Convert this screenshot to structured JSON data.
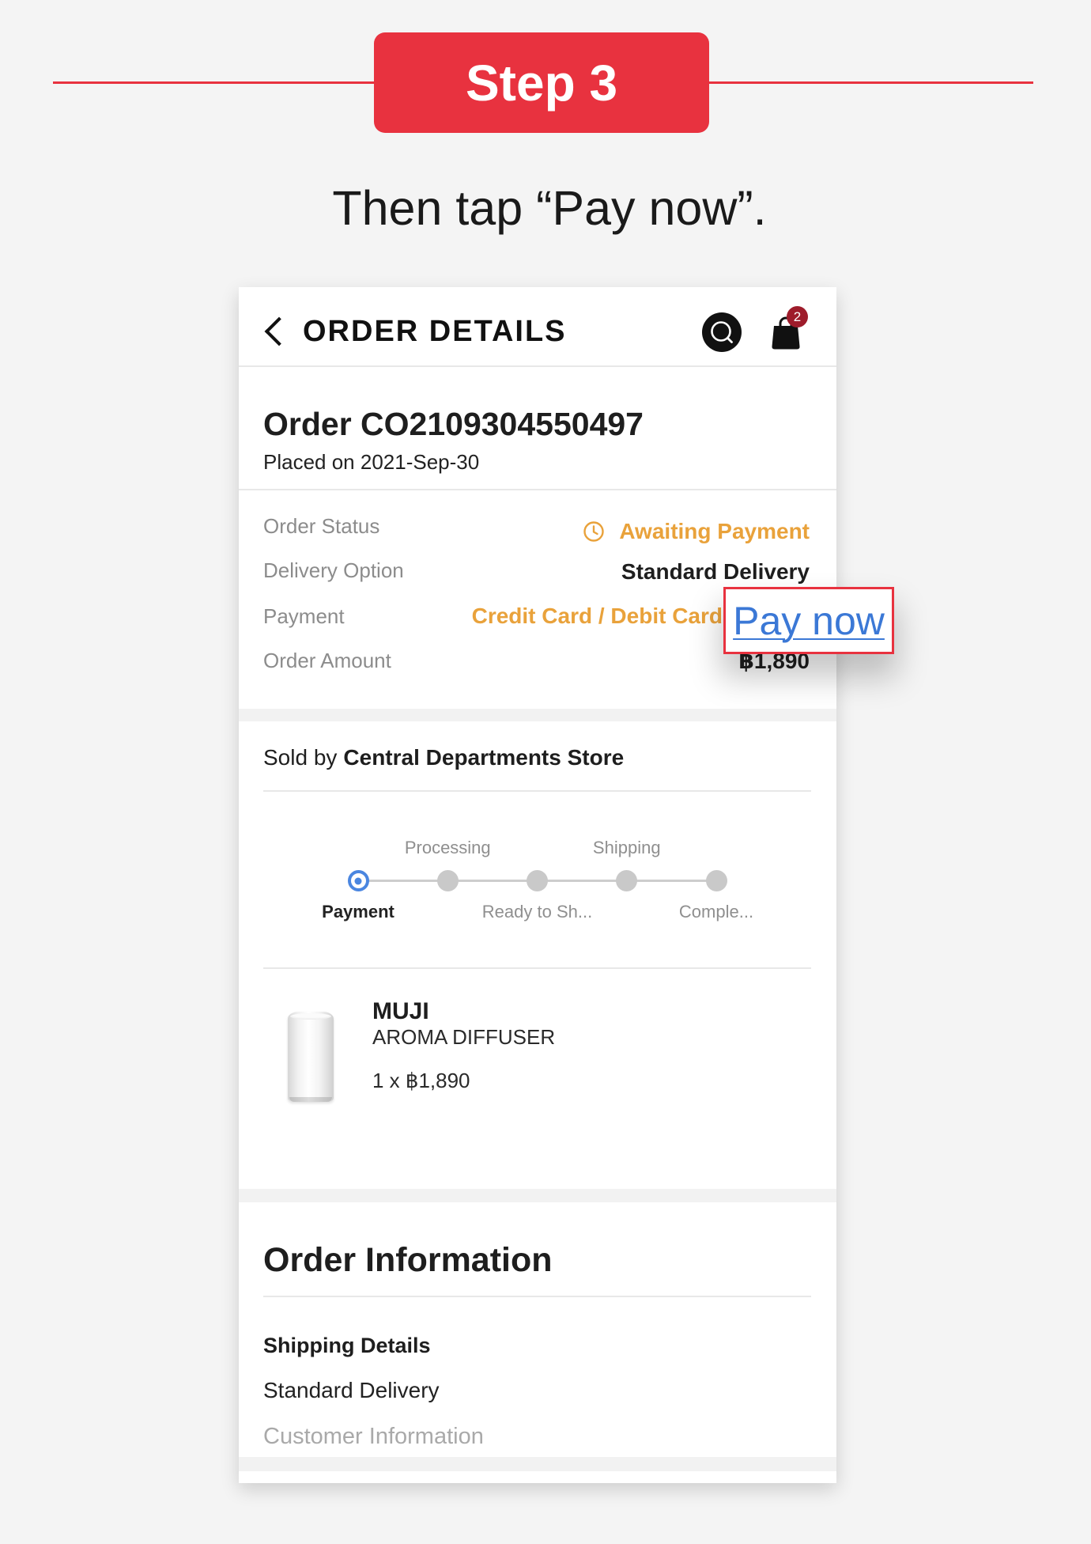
{
  "step_badge": {
    "label": "Step 3"
  },
  "instruction": "Then tap “Pay now”.",
  "colors": {
    "accent_red": "#e8323f",
    "status_orange": "#e9a23b",
    "link_blue": "#3b78d6",
    "active_step_blue": "#4a86e0",
    "cart_badge": "#9e1c2b"
  },
  "icons": {
    "back": "chevron-left-icon",
    "search": "search-icon",
    "cart": "shopping-bag-icon",
    "status": "clock-icon"
  },
  "header": {
    "title": "ORDER DETAILS",
    "cart_count": "2"
  },
  "order": {
    "title": "Order CO2109304550497",
    "placed_on": "Placed on 2021-Sep-30"
  },
  "details": [
    {
      "label": "Order Status",
      "value": "Awaiting Payment"
    },
    {
      "label": "Delivery Option",
      "value": "Standard Delivery"
    },
    {
      "label": "Payment",
      "value": "Credit Card / Debit Card"
    },
    {
      "label": "Order Amount",
      "value": "฿1,890"
    }
  ],
  "pay_now": {
    "label": "Pay now"
  },
  "seller": {
    "prefix": "Sold by",
    "name": "Central Departments Store"
  },
  "tracker": {
    "steps": [
      {
        "label": "Payment",
        "current": true
      },
      {
        "label": "Processing",
        "current": false
      },
      {
        "label": "Ready to Sh...",
        "current": false
      },
      {
        "label": "Shipping",
        "current": false
      },
      {
        "label": "Comple...",
        "current": false
      }
    ]
  },
  "product": {
    "brand": "MUJI",
    "name": "AROMA DIFFUSER",
    "quantity_price": "1 x ฿1,890"
  },
  "order_information": {
    "title": "Order Information",
    "shipping_heading": "Shipping Details",
    "shipping_value": "Standard Delivery",
    "customer_heading": "Customer Information"
  }
}
